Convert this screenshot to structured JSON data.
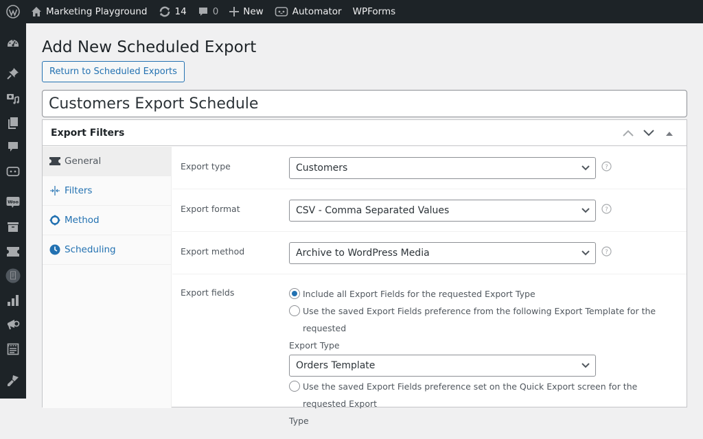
{
  "adminbar": {
    "site_name": "Marketing Playground",
    "updates_count": "14",
    "comments_count": "0",
    "new_label": "New",
    "automator_label": "Automator",
    "wpforms_label": "WPForms"
  },
  "sidebar": {
    "items": [
      {
        "icon": "dashboard-icon"
      },
      {
        "icon": "pin-icon"
      },
      {
        "icon": "media-icon"
      },
      {
        "icon": "pages-icon"
      },
      {
        "icon": "comments-icon"
      },
      {
        "icon": "automator-icon"
      },
      {
        "icon": "woocommerce-icon"
      },
      {
        "icon": "archive-box-icon"
      },
      {
        "icon": "ticket-icon"
      },
      {
        "icon": "document-icon"
      },
      {
        "icon": "analytics-icon"
      },
      {
        "icon": "megaphone-icon"
      },
      {
        "icon": "forms-icon"
      },
      {
        "icon": "appearance-icon"
      }
    ]
  },
  "page": {
    "title": "Add New Scheduled Export",
    "return_button": "Return to Scheduled Exports",
    "schedule_title": "Customers Export Schedule"
  },
  "postbox": {
    "title": "Export Filters",
    "tabs": [
      {
        "label": "General",
        "icon": "ticket-icon",
        "active": true
      },
      {
        "label": "Filters",
        "icon": "filters-icon",
        "active": false
      },
      {
        "label": "Method",
        "icon": "method-icon",
        "active": false
      },
      {
        "label": "Scheduling",
        "icon": "clock-icon",
        "active": false
      }
    ],
    "rows": {
      "export_type": {
        "label": "Export type",
        "value": "Customers"
      },
      "export_format": {
        "label": "Export format",
        "value": "CSV - Comma Separated Values"
      },
      "export_method": {
        "label": "Export method",
        "value": "Archive to WordPress Media"
      },
      "export_fields": {
        "label": "Export fields",
        "option1": "Include all Export Fields for the requested Export Type",
        "option2": "Use the saved Export Fields preference from the following Export Template for the requested",
        "option2_cont": "Export Type",
        "template_value": "Orders Template",
        "option3": "Use the saved Export Fields preference set on the Quick Export screen for the requested Export",
        "option3_cont": "Type",
        "selected": 1
      }
    }
  }
}
